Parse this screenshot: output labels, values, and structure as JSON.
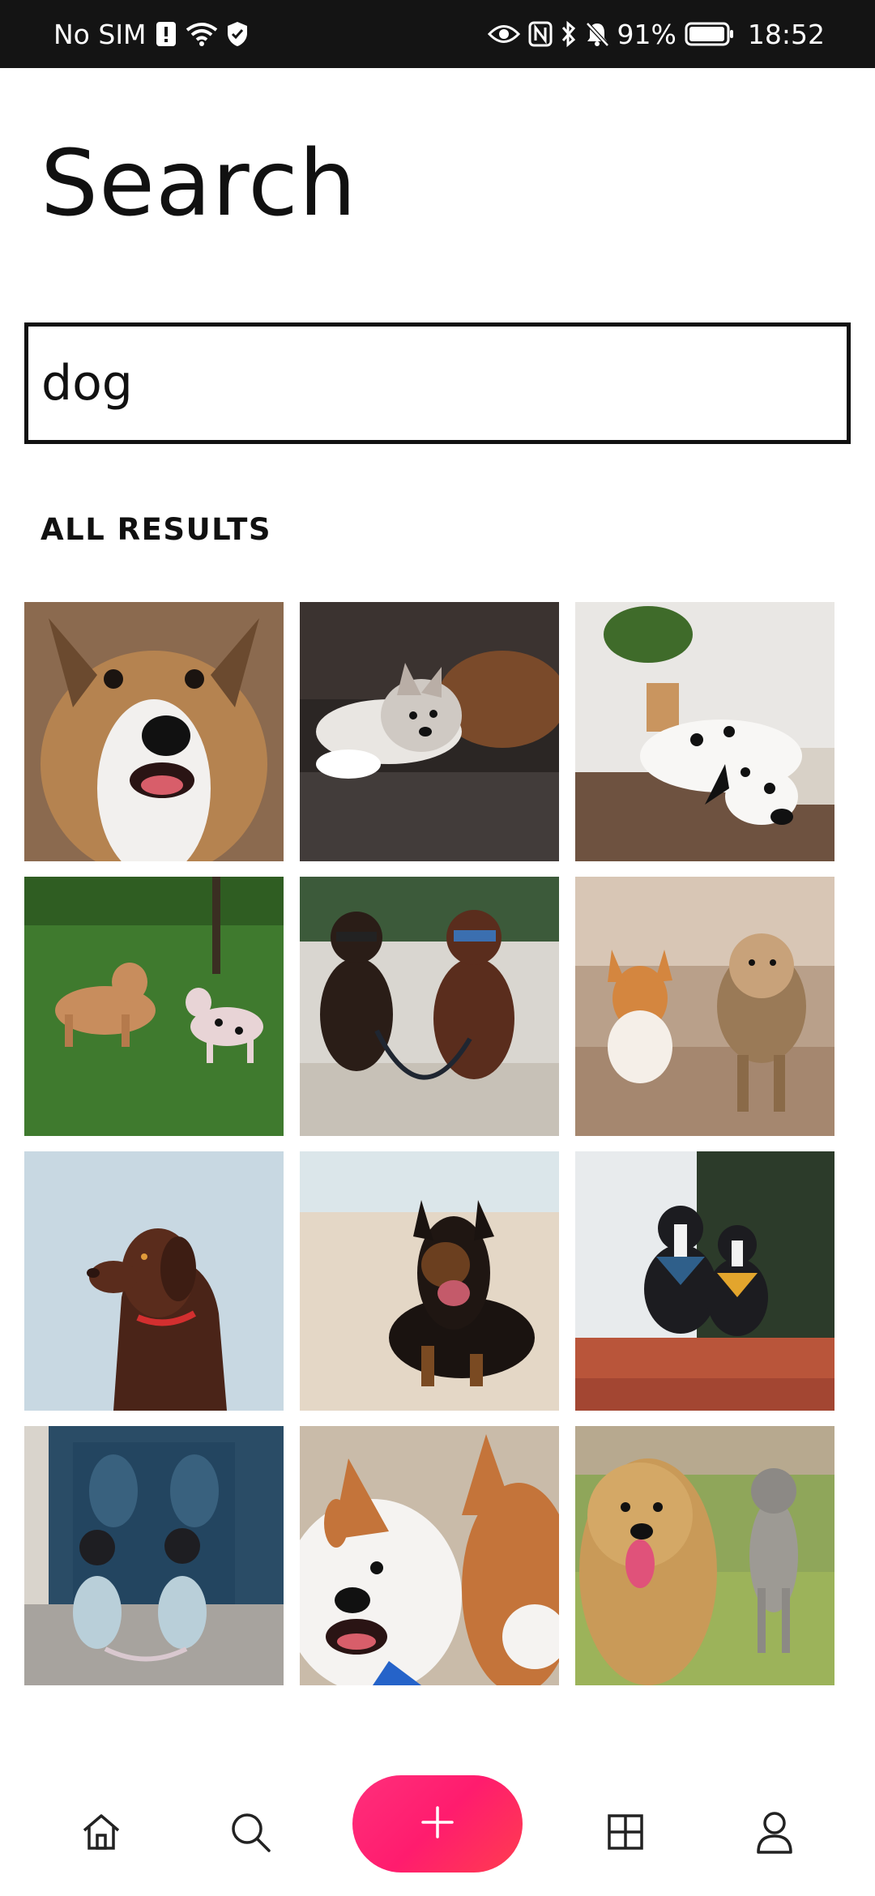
{
  "status_bar": {
    "carrier": "No SIM",
    "battery": "91%",
    "time": "18:52"
  },
  "page": {
    "title": "Search"
  },
  "search": {
    "value": "dog"
  },
  "results": {
    "heading": "ALL RESULTS",
    "items": [
      {
        "name": "result-image-1",
        "icon": "jack-russell-closeup"
      },
      {
        "name": "result-image-2",
        "icon": "husky-puppy-on-couch"
      },
      {
        "name": "result-image-3",
        "icon": "dalmatian-lying"
      },
      {
        "name": "result-image-4",
        "icon": "labrador-and-dalmatian-grass"
      },
      {
        "name": "result-image-5",
        "icon": "two-poodles-sunglasses"
      },
      {
        "name": "result-image-6",
        "icon": "corgi-and-yorkie"
      },
      {
        "name": "result-image-7",
        "icon": "chocolate-labrador"
      },
      {
        "name": "result-image-8",
        "icon": "german-shepherd-beach"
      },
      {
        "name": "result-image-9",
        "icon": "boston-terriers-bandanas"
      },
      {
        "name": "result-image-10",
        "icon": "frenchies-in-sweaters"
      },
      {
        "name": "result-image-11",
        "icon": "shiba-selfie"
      },
      {
        "name": "result-image-12",
        "icon": "doodle-and-schnauzer"
      }
    ]
  },
  "nav": {
    "items": [
      "home-icon",
      "search-icon",
      "add-icon",
      "grid-icon",
      "profile-icon"
    ],
    "accent": "#ff1c6e"
  }
}
